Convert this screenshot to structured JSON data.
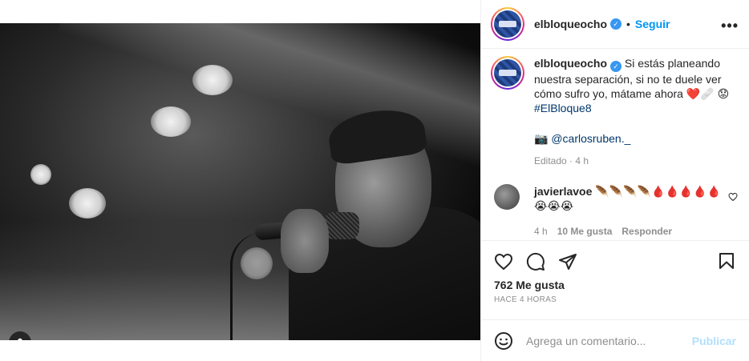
{
  "post": {
    "username": "elbloqueocho",
    "follow_label": "Seguir",
    "separator": "•",
    "more_label": "•••"
  },
  "caption": {
    "username": "elbloqueocho",
    "text": "Si estás planeando nuestra separación, si no te duele ver cómo sufro yo, mátame ahora ❤️🩹",
    "text_line2": "😟",
    "hashtag": "#ElBloque8",
    "camera_emoji": "📷",
    "mention": "@carlosruben._",
    "edited": "Editado",
    "edited_sep": "·",
    "edited_time": "4 h"
  },
  "comment": {
    "username": "javierlavoe",
    "text": "🪶🪶🪶🪶🩸🩸🩸🩸🩸",
    "text_line2": "😭😭😭",
    "time": "4 h",
    "likes": "10 Me gusta",
    "reply": "Responder"
  },
  "likes_label": "762 Me gusta",
  "timestamp": "Hace 4 horas",
  "comment_box": {
    "placeholder": "Agrega un comentario...",
    "publish_label": "Publicar"
  },
  "icons": {
    "like": "heart-icon",
    "comment": "comment-icon",
    "share": "send-icon",
    "save": "bookmark-icon",
    "emoji": "emoji-icon",
    "tag": "user-tag-icon",
    "verified": "verified-badge-icon",
    "more": "more-options-icon"
  },
  "colors": {
    "link_blue": "#0095f6",
    "hashtag_blue": "#00376b",
    "verified_blue": "#3897f0",
    "muted_gray": "#8e8e8e",
    "publish_disabled": "#b2dffc"
  }
}
